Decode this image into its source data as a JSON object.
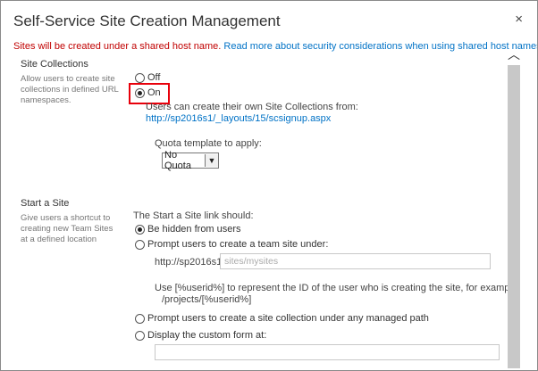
{
  "dialog": {
    "title": "Self-Service Site Creation Management",
    "close_icon": "×"
  },
  "notice": {
    "warning": "Sites will be created under a shared host name.",
    "link": "Read more about security considerations when using shared host names."
  },
  "site_collections": {
    "title": "Site Collections",
    "description": "Allow users to create site collections in defined URL namespaces.",
    "options": [
      "Off",
      "On"
    ],
    "selected": "On",
    "info": "Users can create their own Site Collections from:",
    "signup_url": "http://sp2016s1/_layouts/15/scsignup.aspx",
    "quota_label": "Quota template to apply:",
    "quota_value": "No Quota"
  },
  "start_a_site": {
    "title": "Start a Site",
    "description": "Give users a shortcut to creating new Team Sites at a defined location",
    "prompt": "The Start a Site link should:",
    "options": [
      "Be hidden from users",
      "Prompt users to create a team site under:",
      "Prompt users to create a site collection under any managed path",
      "Display the custom form at:"
    ],
    "selected_index": 0,
    "url_prefix": "http://sp2016s1/",
    "url_placeholder": "sites/mysites",
    "help_line1": "Use [%userid%] to represent the ID of the user who is creating the site, for example:",
    "help_line2": "/projects/[%userid%]"
  },
  "scrollbar": {
    "up_icon": "︿"
  }
}
